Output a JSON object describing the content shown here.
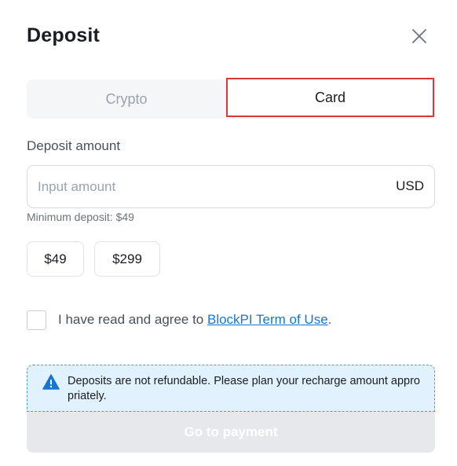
{
  "header": {
    "title": "Deposit"
  },
  "tabs": [
    {
      "label": "Crypto",
      "active": false
    },
    {
      "label": "Card",
      "active": true
    }
  ],
  "amount": {
    "label": "Deposit amount",
    "placeholder": "Input amount",
    "value": "",
    "currency": "USD",
    "minimum_note": "Minimum deposit: $49"
  },
  "quick_amounts": [
    "$49",
    "$299"
  ],
  "agreement": {
    "checked": false,
    "prefix": "I have read and agree to ",
    "link_text": "BlockPI Term of Use",
    "suffix": "."
  },
  "notice": {
    "icon": "warning-icon",
    "text": "Deposits are not refundable. Please plan your recharge amount appropriately."
  },
  "submit": {
    "label": "Go to payment",
    "disabled": true
  },
  "colors": {
    "active_tab_border": "#d9363e",
    "link": "#1677d2",
    "notice_bg": "#e1f1fd",
    "warning_icon": "#1677d2",
    "disabled_button_bg": "#e6e8eb"
  }
}
